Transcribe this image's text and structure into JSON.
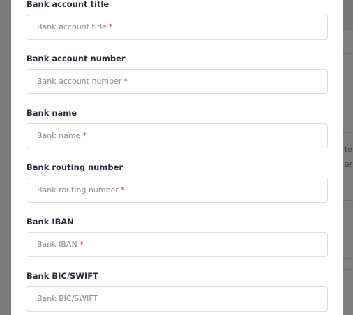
{
  "colors": {
    "overlay": "#7d7d7d",
    "modal_bg": "#ffffff",
    "label": "#2a2a3a",
    "placeholder": "#8a8a8a",
    "required": "#e0303a",
    "input_border": "#dcdcdc"
  },
  "background": {
    "partial_text": [
      "to",
      "ar a"
    ]
  },
  "form": {
    "required_mark": "*",
    "fields": [
      {
        "label": "Bank account title",
        "placeholder": "Bank account title",
        "required": true
      },
      {
        "label": "Bank account number",
        "placeholder": "Bank account number",
        "required": true
      },
      {
        "label": "Bank name",
        "placeholder": "Bank name",
        "required": true
      },
      {
        "label": "Bank routing number",
        "placeholder": "Bank routing number",
        "required": true
      },
      {
        "label": "Bank IBAN",
        "placeholder": "Bank IBAN",
        "required": true
      },
      {
        "label": "Bank BIC/SWIFT",
        "placeholder": "Bank BIC/SWIFT",
        "required": false
      }
    ]
  }
}
